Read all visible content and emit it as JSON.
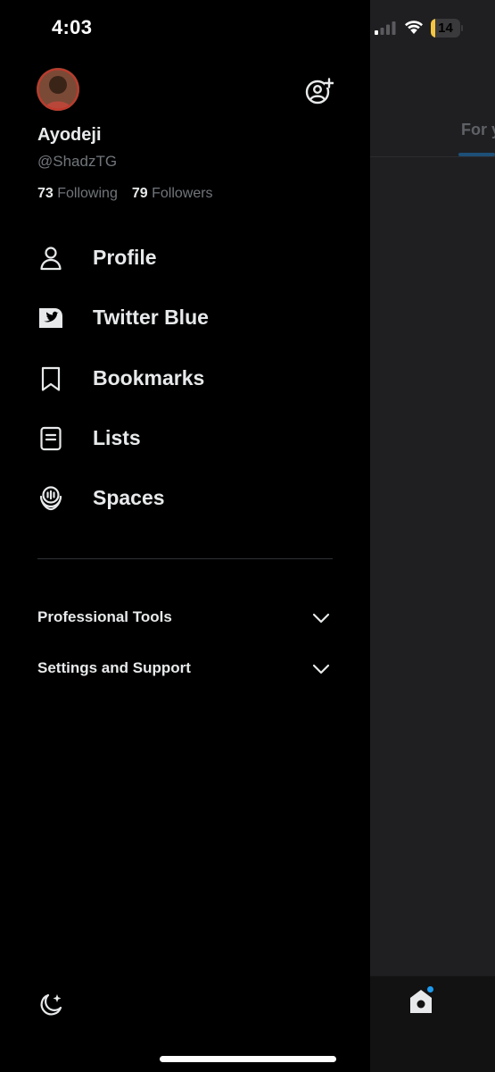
{
  "status_bar": {
    "time": "4:03",
    "battery_level": "14",
    "battery_fraction": 0.14,
    "signal_icon": "cellular-signal-icon",
    "wifi_icon": "wifi-icon"
  },
  "drawer": {
    "user": {
      "display_name": "Ayodeji",
      "handle": "@ShadzTG",
      "following_count": "73",
      "following_label": "Following",
      "followers_count": "79",
      "followers_label": "Followers"
    },
    "menu": [
      {
        "label": "Profile",
        "icon": "person-icon"
      },
      {
        "label": "Twitter Blue",
        "icon": "twitter-blue-icon"
      },
      {
        "label": "Bookmarks",
        "icon": "bookmark-icon"
      },
      {
        "label": "Lists",
        "icon": "lists-icon"
      },
      {
        "label": "Spaces",
        "icon": "spaces-icon"
      }
    ],
    "sections": [
      {
        "label": "Professional Tools",
        "icon": "chevron-down-icon"
      },
      {
        "label": "Settings and Support",
        "icon": "chevron-down-icon"
      }
    ],
    "theme_toggle_icon": "moon-icon",
    "add_account_icon": "add-account-icon"
  },
  "timeline_peek": {
    "tab_label": "For y",
    "home_icon": "home-icon"
  },
  "colors": {
    "background": "#000000",
    "text_primary": "#e7e9ea",
    "text_secondary": "#71767b",
    "accent": "#1d9bf0",
    "battery": "#f5c542"
  }
}
